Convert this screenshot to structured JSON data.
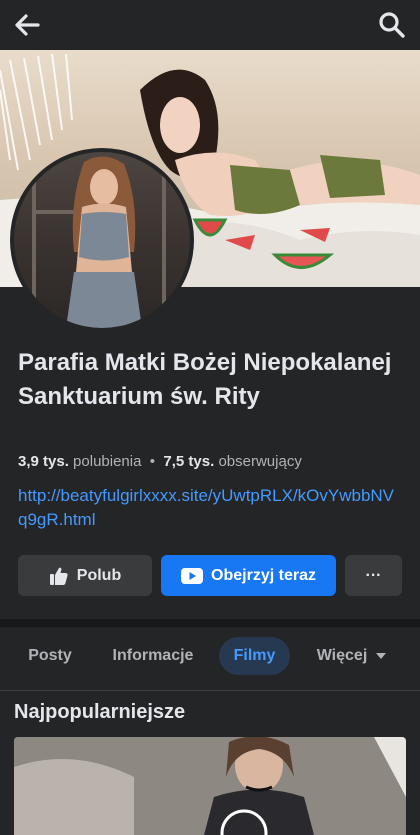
{
  "header": {
    "back_icon": "arrow-left-icon",
    "search_icon": "search-icon"
  },
  "page": {
    "name": "Parafia  Matki Bożej Niepokalanej  Sanktuarium św. Rity",
    "likes_count": "3,9 tys.",
    "likes_label": "polubienia",
    "separator": "•",
    "followers_count": "7,5 tys.",
    "followers_label": "obserwujący",
    "link": "http://beatyfulgirlxxxx.site/yUwtpRLX/kOvYwbbNVq9gR.html"
  },
  "actions": {
    "like_label": "Polub",
    "watch_label": "Obejrzyj teraz",
    "more_label": "···"
  },
  "tabs": [
    {
      "label": "Posty"
    },
    {
      "label": "Informacje"
    },
    {
      "label": "Filmy",
      "active": true
    },
    {
      "label": "Więcej"
    }
  ],
  "section": {
    "title": "Najpopularniejsze"
  },
  "colors": {
    "background": "#242526",
    "accent": "#1877f2",
    "link": "#4599ff",
    "active_tab_bg": "#263951"
  }
}
